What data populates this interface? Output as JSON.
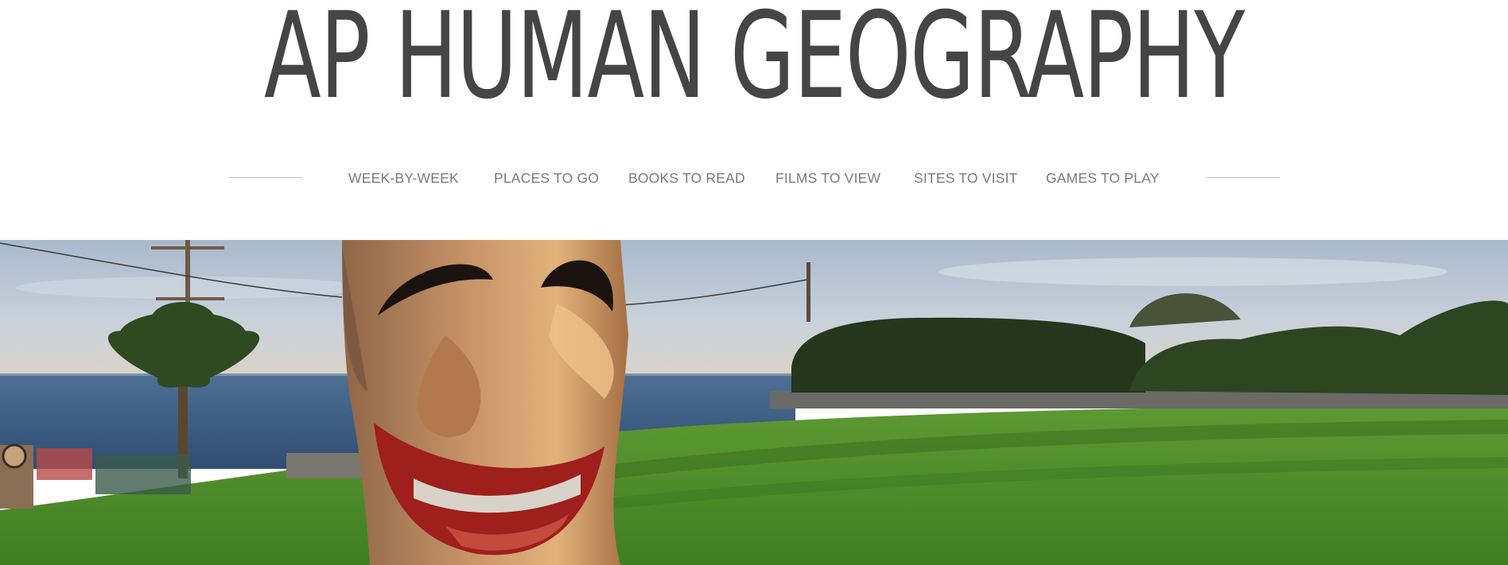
{
  "site": {
    "title": "AP HUMAN GEOGRAPHY"
  },
  "nav": {
    "items": [
      {
        "label": "WEEK-BY-WEEK"
      },
      {
        "label": "PLACES TO GO"
      },
      {
        "label": "BOOKS TO READ"
      },
      {
        "label": "FILMS TO VIEW"
      },
      {
        "label": "SITES TO VISIT"
      },
      {
        "label": "GAMES TO PLAY"
      }
    ]
  },
  "colors": {
    "title": "#454545",
    "nav_text": "#7a7a7a",
    "divider": "#bdbdbd",
    "sky": "#b9c7d6",
    "sea": "#3e5f85",
    "grass": "#4d8f2a",
    "hedge": "#23361c",
    "carving": "#c78b5b",
    "mouth": "#9e1f1c"
  },
  "hero": {
    "image_icon": "carved-tiki-mask-park-photo"
  }
}
